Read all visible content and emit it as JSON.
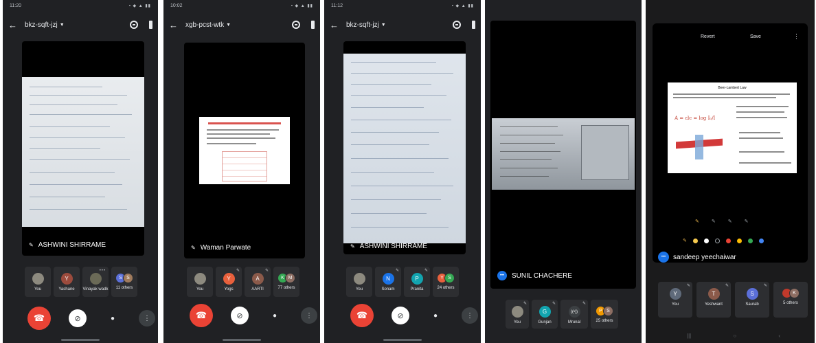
{
  "phones": [
    {
      "status": {
        "time": "11:20",
        "icons": "▪ ◆ ▲ ▮▮"
      },
      "meeting_code": "bkz-sqft-jzj",
      "presenter": "ASHWINI SHIRRAME",
      "tiles": [
        {
          "label": "You",
          "initial": "",
          "color": "#8d8a7f"
        },
        {
          "label": "Yashane",
          "initial": "Y",
          "color": "#9c4b3d"
        },
        {
          "label": "Vinayak wadk",
          "initial": "",
          "color": "#6b6a57"
        },
        {
          "label": "11 others",
          "initials": [
            "S",
            "S"
          ],
          "colors": [
            "#5b6fd8",
            "#a07b5d"
          ]
        }
      ]
    },
    {
      "status": {
        "time": "10:02",
        "icons": "▪ ◆ ▲ ▮▮"
      },
      "meeting_code": "xgb-pcst-wtk",
      "presenter": "Waman Parwate",
      "tiles": [
        {
          "label": "You",
          "initial": "",
          "color": "#8d8a7f"
        },
        {
          "label": "Yogs",
          "initial": "Y",
          "color": "#e8603c"
        },
        {
          "label": "AARTI",
          "initial": "A",
          "color": "#8b5a4a"
        },
        {
          "label": "77 others",
          "initials": [
            "K",
            "M"
          ],
          "colors": [
            "#34a853",
            "#8d6e63"
          ]
        }
      ]
    },
    {
      "status": {
        "time": "11:12",
        "icons": "▪ ◆ ▲ ▮▮"
      },
      "meeting_code": "bkz-sqft-jzj",
      "presenter": "ASHWINI SHIRRAME",
      "tiles": [
        {
          "label": "You",
          "initial": "",
          "color": "#8d8a7f"
        },
        {
          "label": "Sonam",
          "initial": "N",
          "color": "#1a73e8"
        },
        {
          "label": "Pranita",
          "initial": "P",
          "color": "#12a4af"
        },
        {
          "label": "24 others",
          "initials": [
            "Y",
            "S"
          ],
          "colors": [
            "#e8603c",
            "#34a853"
          ]
        }
      ]
    },
    {
      "presenter": "SUNIL CHACHERE",
      "tiles": [
        {
          "label": "You",
          "initial": "",
          "color": "#8d8a7f"
        },
        {
          "label": "Gunjan",
          "initial": "G",
          "color": "#12a4af"
        },
        {
          "label": "Mrunal",
          "initial": "((•))",
          "color": "#3c4043"
        },
        {
          "label": "25 others",
          "initials": [
            "P",
            "S"
          ],
          "colors": [
            "#f29900",
            "#8d6e63"
          ]
        }
      ]
    },
    {
      "editor": {
        "revert_label": "Revert",
        "save_label": "Save",
        "slide_title": "Beer-Lambert Law",
        "formula": "A = εlc = log I₀/I"
      },
      "presenter": "sandeep yeechaiwar",
      "tiles": [
        {
          "label": "You",
          "initial": "Y",
          "color": "#5f6a7a"
        },
        {
          "label": "Yeshwant",
          "initial": "T",
          "color": "#8b5a4a"
        },
        {
          "label": "Saurab",
          "initial": "S",
          "color": "#5b6fd8"
        },
        {
          "label": "5 others",
          "initials": [
            "",
            "K"
          ],
          "colors": [
            "#c0392b",
            "#8d6e63"
          ]
        }
      ]
    }
  ],
  "colors": {
    "end_call": "#ea4335",
    "background": "#202124",
    "tile": "#2d2e31"
  },
  "icons": [
    "back-arrow-icon",
    "switch-camera-icon",
    "audio-output-icon",
    "mic-off-icon",
    "end-call-icon",
    "camera-off-icon",
    "microphone-icon",
    "more-options-icon"
  ]
}
